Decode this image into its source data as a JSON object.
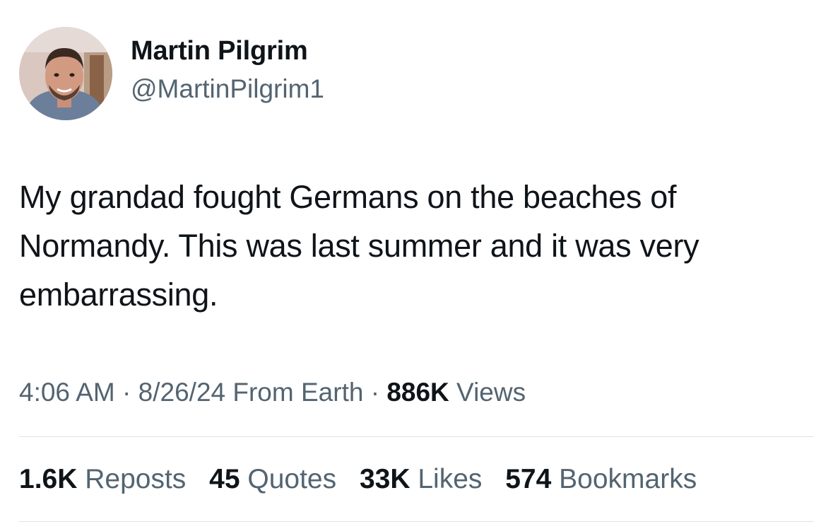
{
  "author": {
    "display_name": "Martin Pilgrim",
    "handle": "@MartinPilgrim1"
  },
  "tweet": {
    "text": "My grandad fought Germans on the beaches of Normandy. This was last summer and it was very embarrassing."
  },
  "meta": {
    "time": "4:06 AM",
    "separator": " · ",
    "date": "8/26/24",
    "source": " From Earth",
    "views_count": "886K",
    "views_label": " Views"
  },
  "stats": {
    "reposts_count": "1.6K",
    "reposts_label": " Reposts",
    "quotes_count": "45",
    "quotes_label": " Quotes",
    "likes_count": "33K",
    "likes_label": " Likes",
    "bookmarks_count": "574",
    "bookmarks_label": " Bookmarks"
  },
  "colors": {
    "text_primary": "#0f1419",
    "text_secondary": "#536471",
    "divider": "#dfe3e7",
    "background": "#ffffff"
  }
}
